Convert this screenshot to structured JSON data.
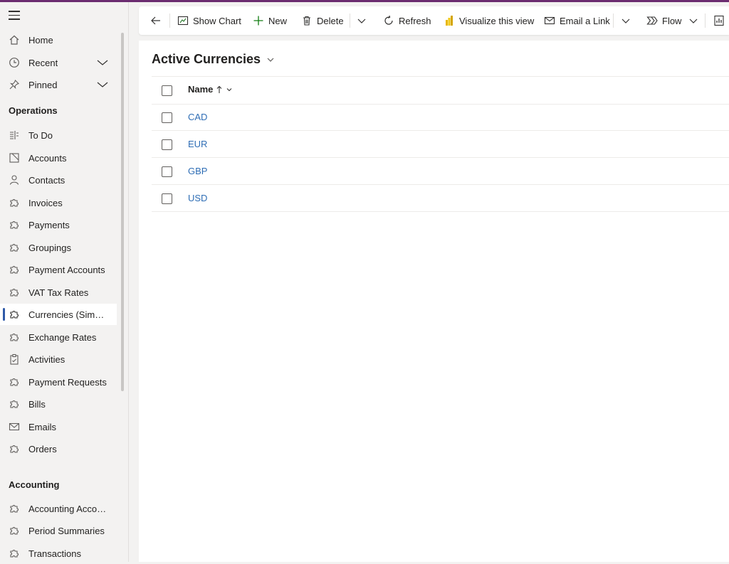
{
  "sidebar": {
    "items": [
      {
        "label": "Home",
        "icon": "home-icon"
      },
      {
        "label": "Recent",
        "icon": "clock-icon"
      },
      {
        "label": "Pinned",
        "icon": "pin-icon"
      }
    ],
    "operations_header": "Operations",
    "operations": [
      {
        "label": "To Do",
        "icon": "todo-icon"
      },
      {
        "label": "Accounts",
        "icon": "accounts-icon"
      },
      {
        "label": "Contacts",
        "icon": "person-icon"
      },
      {
        "label": "Invoices",
        "icon": "puzzle-icon"
      },
      {
        "label": "Payments",
        "icon": "puzzle-icon"
      },
      {
        "label": "Groupings",
        "icon": "puzzle-icon"
      },
      {
        "label": "Payment Accounts",
        "icon": "puzzle-icon"
      },
      {
        "label": "VAT Tax Rates",
        "icon": "puzzle-icon"
      },
      {
        "label": "Currencies (Simpl...",
        "icon": "puzzle-icon"
      },
      {
        "label": "Exchange Rates",
        "icon": "puzzle-icon"
      },
      {
        "label": "Activities",
        "icon": "clipboard-icon"
      },
      {
        "label": "Payment Requests",
        "icon": "puzzle-icon"
      },
      {
        "label": "Bills",
        "icon": "puzzle-icon"
      },
      {
        "label": "Emails",
        "icon": "mail-icon"
      },
      {
        "label": "Orders",
        "icon": "puzzle-icon"
      }
    ],
    "accounting_header": "Accounting",
    "accounting": [
      {
        "label": "Accounting Accou...",
        "icon": "puzzle-icon"
      },
      {
        "label": "Period Summaries",
        "icon": "puzzle-icon"
      },
      {
        "label": "Transactions",
        "icon": "puzzle-icon"
      }
    ]
  },
  "toolbar": {
    "show_chart": "Show Chart",
    "new": "New",
    "delete": "Delete",
    "refresh": "Refresh",
    "visualize": "Visualize this view",
    "email_link": "Email a Link",
    "flow": "Flow"
  },
  "view": {
    "title": "Active Currencies",
    "column_name": "Name",
    "rows": [
      "CAD",
      "EUR",
      "GBP",
      "USD"
    ]
  },
  "colors": {
    "accent": "#6b2c70",
    "link": "#2f6eb5",
    "selected_indicator": "#2f5aa8",
    "powerbi_yellow": "#f2c811"
  }
}
